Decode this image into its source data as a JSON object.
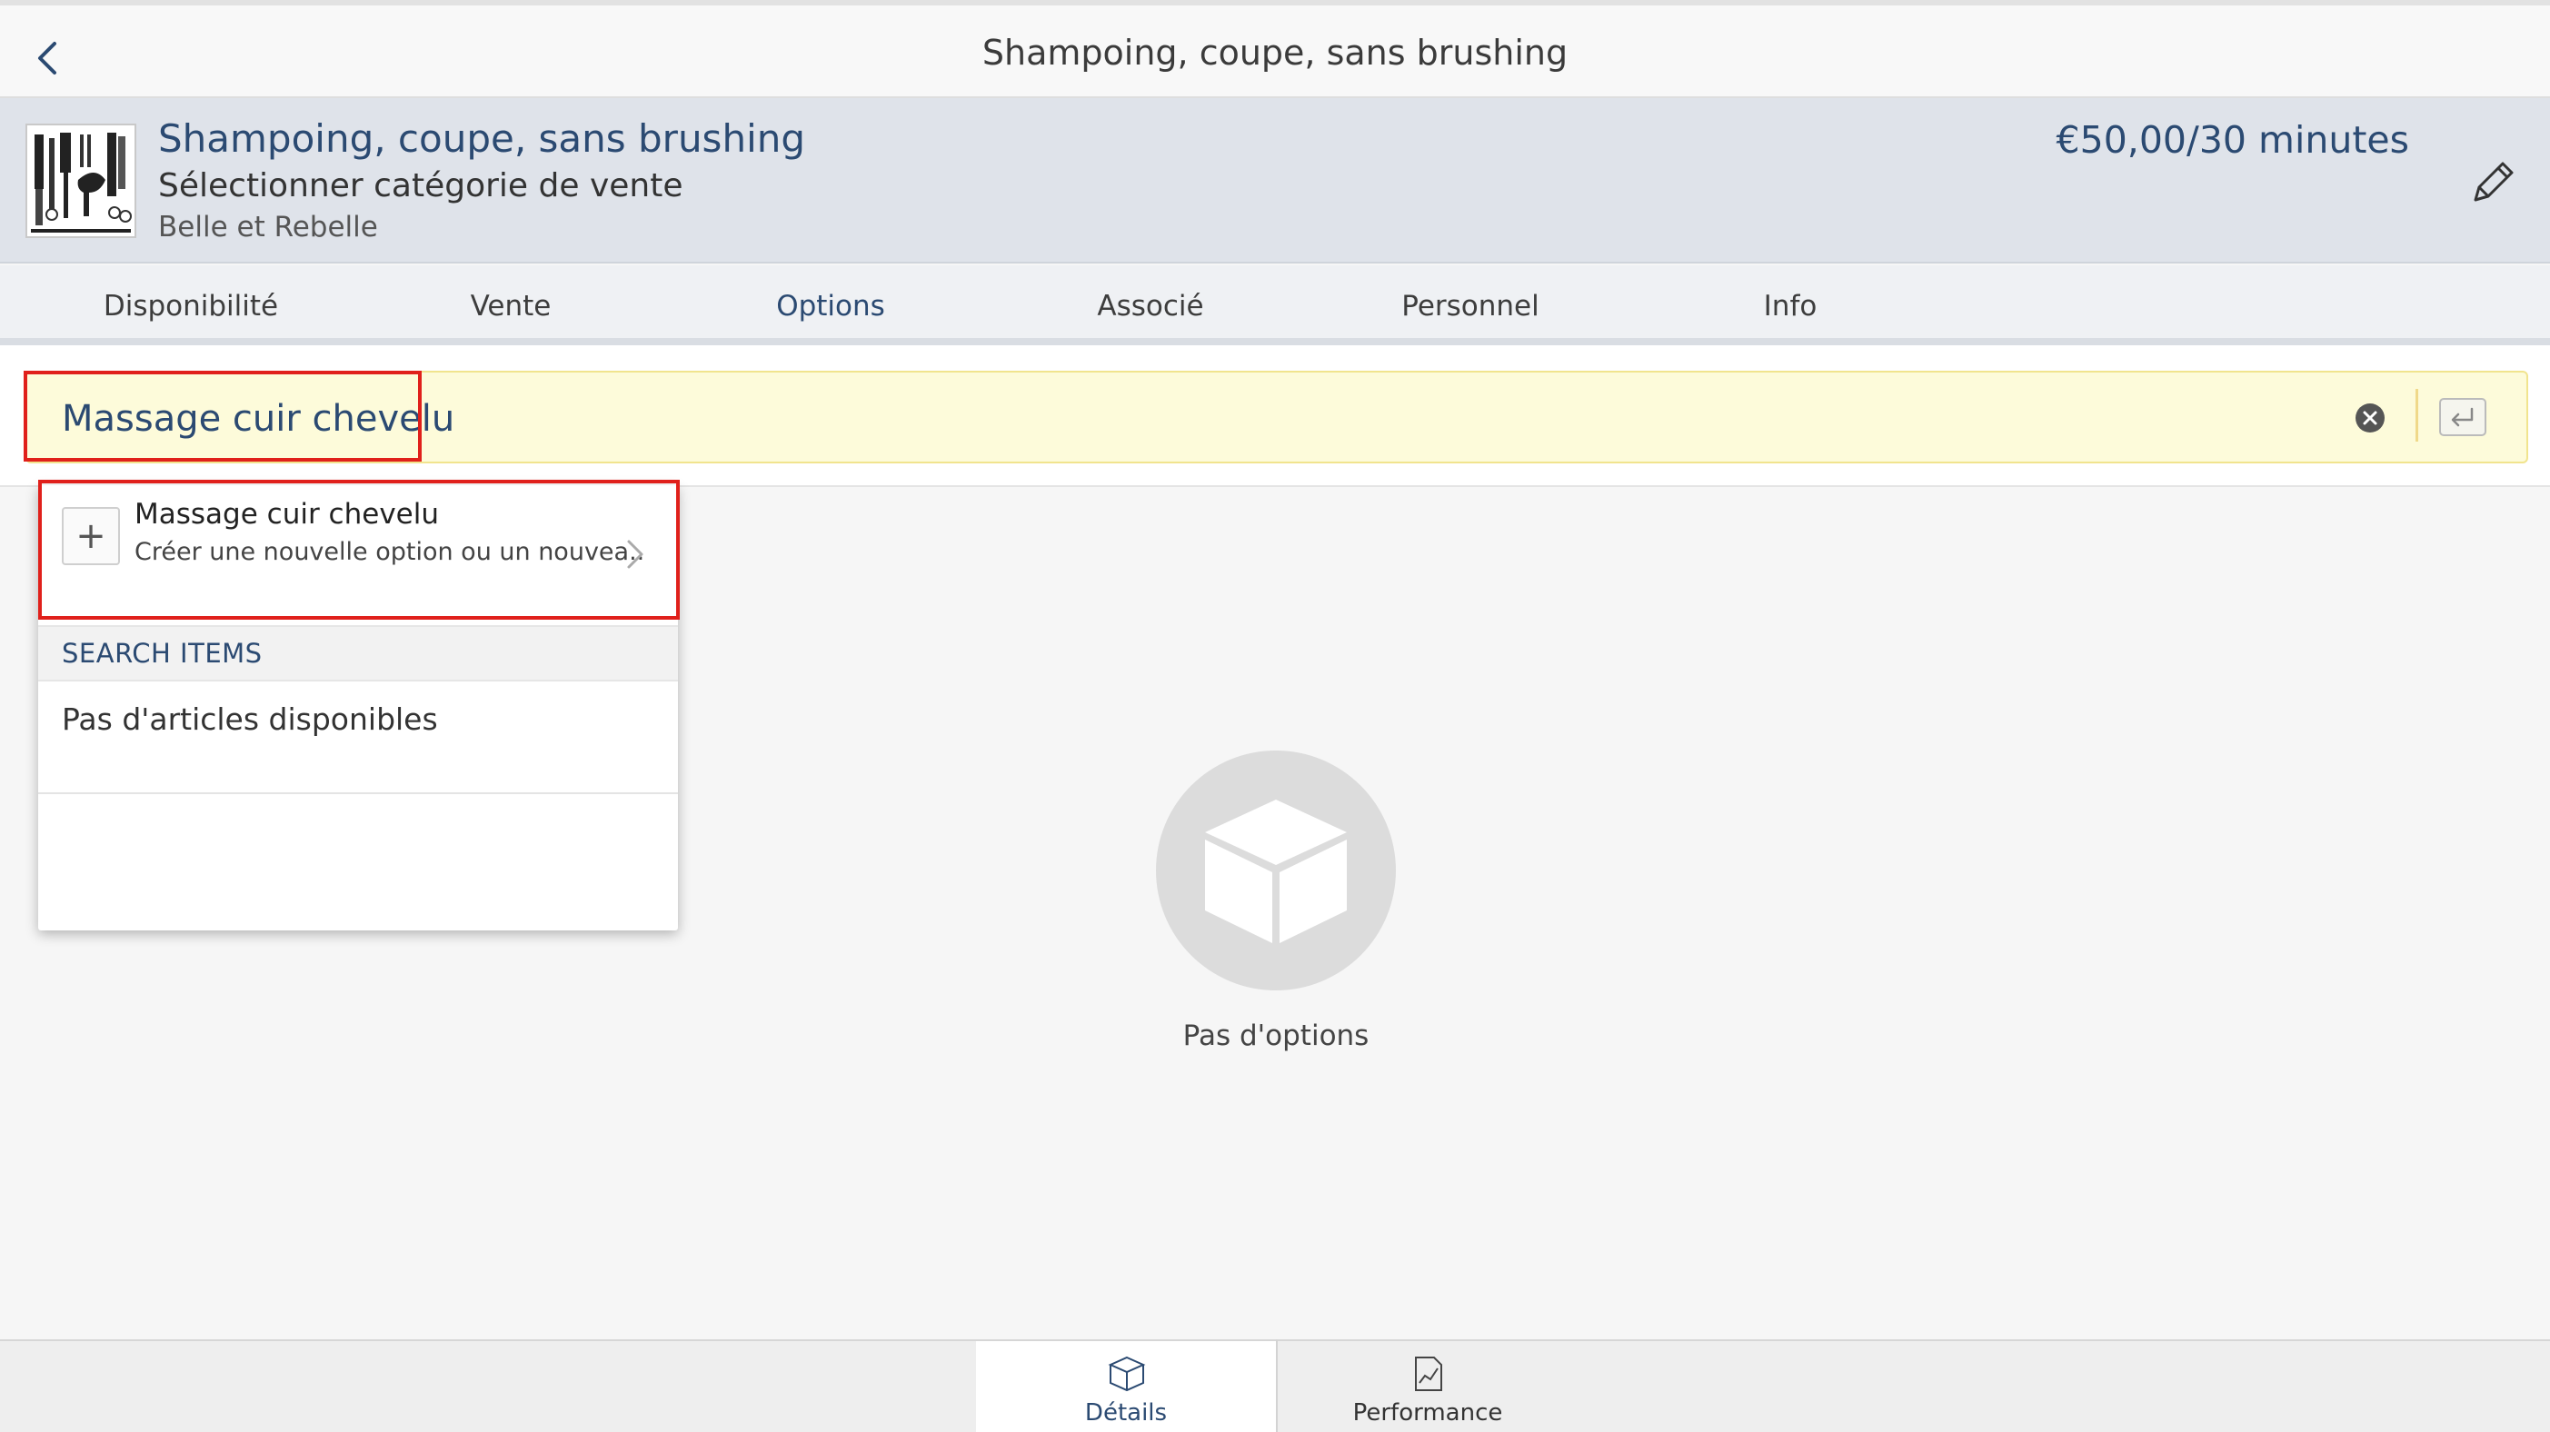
{
  "navbar": {
    "title": "Shampoing, coupe, sans brushing",
    "back_icon": "chevron-left-icon"
  },
  "service": {
    "name": "Shampoing, coupe, sans brushing",
    "category": "Sélectionner catégorie de vente",
    "owner": "Belle et Rebelle",
    "price": "€50,00/30 minutes",
    "edit_icon": "pencil-icon",
    "thumbnail_icon": "hair-tools-icon"
  },
  "tabs": [
    {
      "label": "Disponibilité"
    },
    {
      "label": "Vente"
    },
    {
      "label": "Options"
    },
    {
      "label": "Associé"
    },
    {
      "label": "Personnel"
    },
    {
      "label": "Info"
    }
  ],
  "active_tab": "Options",
  "search": {
    "value": "Massage cuir chevelu",
    "clear_icon": "clear-icon",
    "return_icon": "return-icon"
  },
  "dropdown": {
    "create": {
      "icon": "plus-icon",
      "title": "Massage cuir chevelu",
      "subtitle": "Créer une nouvelle option ou un nouvea..."
    },
    "section_header": "SEARCH ITEMS",
    "empty_text": "Pas d'articles disponibles"
  },
  "empty_state": {
    "icon": "box-icon",
    "label": "Pas d'options"
  },
  "bottom_tabs": [
    {
      "label": "Détails",
      "icon": "box-icon"
    },
    {
      "label": "Performance",
      "icon": "chart-document-icon"
    }
  ],
  "colors": {
    "accent": "#2b4a72",
    "highlight": "#e0201b",
    "search_bg": "#fdfbda"
  }
}
